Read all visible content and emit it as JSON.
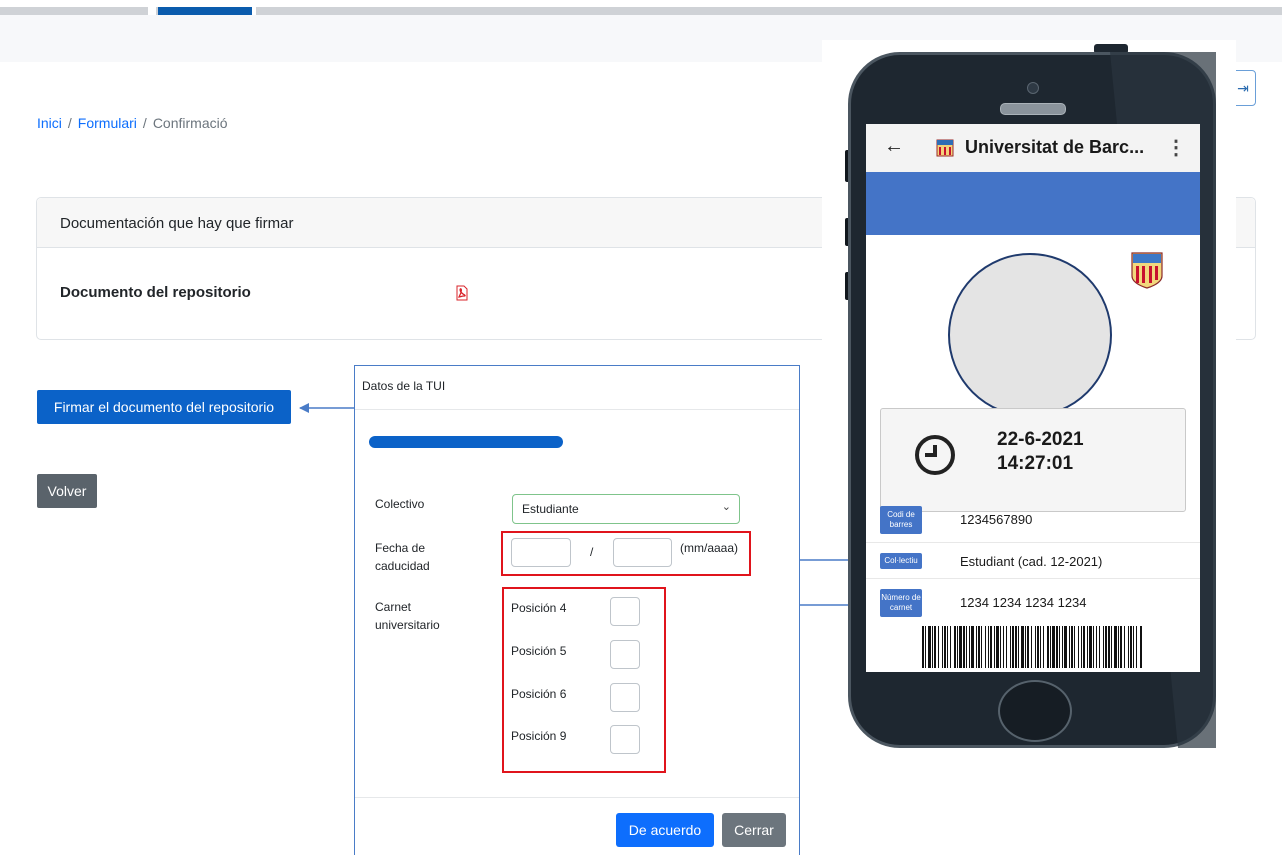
{
  "breadcrumb": {
    "home": "Inici",
    "form": "Formulari",
    "current": "Confirmació",
    "separator": "/"
  },
  "header": {
    "exit_icon": "exit-icon"
  },
  "card": {
    "header": "Documentación que hay que firmar",
    "doc_label": "Documento del repositorio",
    "doc_icon": "pdf-icon"
  },
  "actions": {
    "sign": "Firmar el documento del repositorio",
    "back": "Volver"
  },
  "modal": {
    "title": "Datos de la TUI",
    "collective_label": "Colectivo",
    "collective_value": "Estudiante",
    "expiry_label_1": "Fecha de",
    "expiry_label_2": "caducidad",
    "expiry_separator": "/",
    "expiry_hint": "(mm/aaaa)",
    "card_label_1": "Carnet",
    "card_label_2": "universitario",
    "positions": [
      "Posición 4",
      "Posición 5",
      "Posición 6",
      "Posición 9"
    ],
    "ok": "De acuerdo",
    "close": "Cerrar"
  },
  "phone": {
    "app_title": "Universitat de Barc...",
    "date": "22-6-2021",
    "time": "14:27:01",
    "rows": [
      {
        "badge_1": "Codi de",
        "badge_2": "barres",
        "value": "1234567890"
      },
      {
        "badge_1": "Col·lectiu",
        "badge_2": "",
        "value": "Estudiant (cad. 12-2021)"
      },
      {
        "badge_1": "Número de",
        "badge_2": "carnet",
        "value": "1234 1234 1234 1234"
      }
    ]
  },
  "colors": {
    "primary": "#0b62c8",
    "secondary": "#5a636b",
    "highlight": "#e0141c",
    "arrow": "#4a7cc7",
    "app_blue": "#4474c7"
  }
}
